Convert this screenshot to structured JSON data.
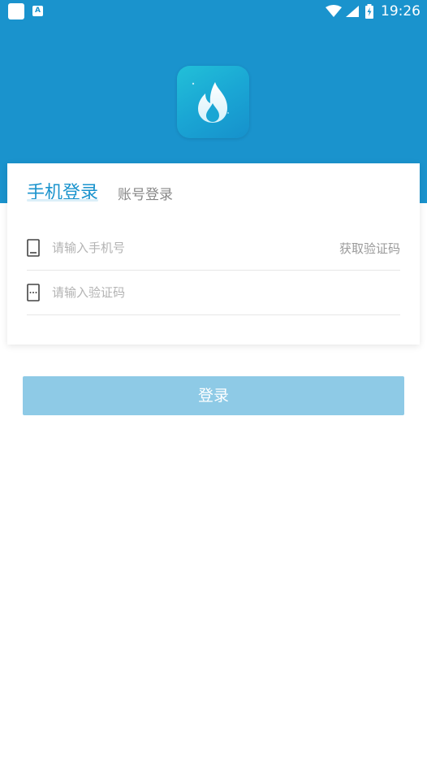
{
  "status_bar": {
    "time": "19:26",
    "notification_badge": "A"
  },
  "colors": {
    "primary": "#1a93cd",
    "button_disabled": "#8ecae6",
    "placeholder": "#b3b3b3"
  },
  "logo": {
    "icon": "flame-icon"
  },
  "tabs": [
    {
      "label": "手机登录",
      "active": true
    },
    {
      "label": "账号登录",
      "active": false
    }
  ],
  "form": {
    "phone": {
      "placeholder": "请输入手机号",
      "value": "",
      "icon": "phone-icon"
    },
    "get_code_label": "获取验证码",
    "code": {
      "placeholder": "请输入验证码",
      "value": "",
      "icon": "code-icon"
    }
  },
  "login_button_label": "登录"
}
